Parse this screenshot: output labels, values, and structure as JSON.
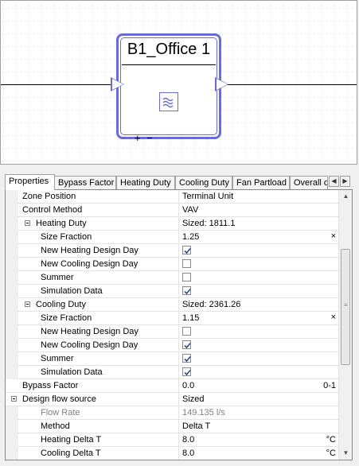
{
  "diagram": {
    "zone_title": "B1_Office 1",
    "zone_icon": "vav-coil-icon",
    "plus_minus": "+ −",
    "accent_color": "#6a6ad8"
  },
  "tabs": [
    {
      "label": "Properties",
      "active": true
    },
    {
      "label": "Bypass Factor"
    },
    {
      "label": "Heating Duty"
    },
    {
      "label": "Cooling Duty"
    },
    {
      "label": "Fan Partload"
    },
    {
      "label": "Overall d"
    }
  ],
  "tab_scroll": {
    "left": "◀",
    "right": "▶"
  },
  "rows": [
    {
      "name": "Zone Position",
      "value": "Terminal Unit"
    },
    {
      "name": "Control Method",
      "value": "VAV"
    },
    {
      "name": "Heating Duty",
      "value": "Sized: 1811.1",
      "expander": true
    },
    {
      "name": "Size Fraction",
      "value": "1.25",
      "clear": "×"
    },
    {
      "name": "New Heating Design Day",
      "checked": true
    },
    {
      "name": "New Cooling Design Day",
      "checked": false
    },
    {
      "name": "Summer",
      "checked": false
    },
    {
      "name": "Simulation Data",
      "checked": true
    },
    {
      "name": "Cooling Duty",
      "value": "Sized: 2361.26",
      "expander": true
    },
    {
      "name": "Size Fraction",
      "value": "1.15",
      "clear": "×"
    },
    {
      "name": "New Heating Design Day",
      "checked": false
    },
    {
      "name": "New Cooling Design Day",
      "checked": true
    },
    {
      "name": "Summer",
      "checked": true
    },
    {
      "name": "Simulation Data",
      "checked": true
    },
    {
      "name": "Bypass Factor",
      "value": "0.0",
      "unit": "0-1"
    },
    {
      "name": "Design flow source",
      "value": "Sized",
      "expander": true
    },
    {
      "name": "Flow Rate",
      "value": "149.135 l/s",
      "gray": true
    },
    {
      "name": "Method",
      "value": "Delta T"
    },
    {
      "name": "Heating Delta T",
      "value": "8.0",
      "unit": "°C"
    },
    {
      "name": "Cooling Delta T",
      "value": "8.0",
      "unit": "°C"
    }
  ],
  "scrollbar": {
    "up": "▲",
    "down": "▼",
    "grip": "≡"
  }
}
